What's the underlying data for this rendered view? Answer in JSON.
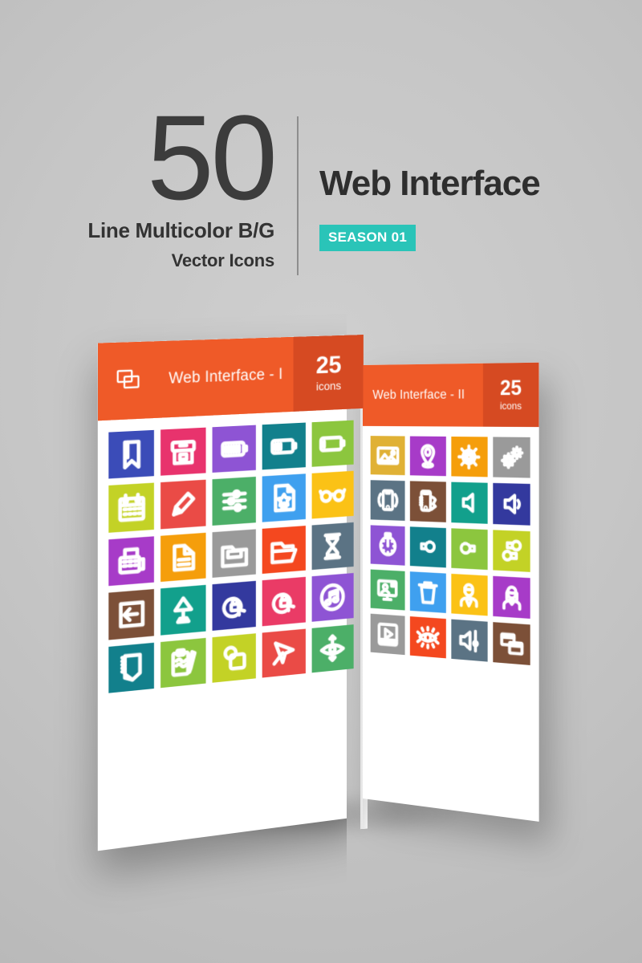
{
  "header": {
    "count": "50",
    "subtitle_1": "Line Multicolor B/G",
    "subtitle_2": "Vector Icons",
    "title": "Web Interface",
    "season_badge": "SEASON 01"
  },
  "colors": {
    "background": "#c4c4c4",
    "bar_orange": "#ef5a28",
    "bar_orange_dark": "#d64a22",
    "badge_teal": "#2ac4b8",
    "text_dark": "#2e2e2e"
  },
  "panels": [
    {
      "id": "panel-front",
      "bar_icon": "windows-icon",
      "title": "Web Interface - I",
      "count": "25",
      "count_label": "icons",
      "tiles": [
        {
          "name": "bookmark-icon",
          "color": "#3b4cb8"
        },
        {
          "name": "archive-box-icon",
          "color": "#e8336d"
        },
        {
          "name": "battery-full-icon",
          "color": "#8e54d4"
        },
        {
          "name": "battery-medium-icon",
          "color": "#12808c"
        },
        {
          "name": "battery-low-icon",
          "color": "#8cc63e"
        },
        {
          "name": "calendar-icon",
          "color": "#c3d226"
        },
        {
          "name": "pencil-edit-icon",
          "color": "#ea4b46"
        },
        {
          "name": "settings-sliders-icon",
          "color": "#4caf68"
        },
        {
          "name": "certificate-file-icon",
          "color": "#3fa0ef"
        },
        {
          "name": "glasses-icon",
          "color": "#fbc216"
        },
        {
          "name": "fax-machine-icon",
          "color": "#a73bc8"
        },
        {
          "name": "document-file-icon",
          "color": "#f59e0b"
        },
        {
          "name": "folder-file-icon",
          "color": "#9a9a9a"
        },
        {
          "name": "folder-open-icon",
          "color": "#f4481f"
        },
        {
          "name": "hourglass-icon",
          "color": "#5b7384"
        },
        {
          "name": "login-arrow-icon",
          "color": "#7c5038"
        },
        {
          "name": "desk-lamp-icon",
          "color": "#12a08c"
        },
        {
          "name": "lock-refresh-icon",
          "color": "#33399e"
        },
        {
          "name": "unlock-refresh-icon",
          "color": "#ea3b66"
        },
        {
          "name": "music-note-icon",
          "color": "#8e54d4"
        },
        {
          "name": "notebook-icon",
          "color": "#12808c"
        },
        {
          "name": "clipboard-pencil-icon",
          "color": "#8cc63e"
        },
        {
          "name": "shapes-icon",
          "color": "#c3d226"
        },
        {
          "name": "cursor-arrow-icon",
          "color": "#ea4b46"
        },
        {
          "name": "eye-move-icon",
          "color": "#4caf68"
        }
      ]
    },
    {
      "id": "panel-back",
      "title": "Web Interface - II",
      "count": "25",
      "count_label": "icons",
      "tiles": [
        {
          "name": "picture-image-icon",
          "color": "#e0b135"
        },
        {
          "name": "location-pin-icon",
          "color": "#a73bc8"
        },
        {
          "name": "gear-icon",
          "color": "#f59e0b"
        },
        {
          "name": "gears-double-icon",
          "color": "#9a9a9a"
        },
        {
          "name": "smartphone-icon",
          "color": "#5b7384"
        },
        {
          "name": "hand-phone-icon",
          "color": "#7c5038"
        },
        {
          "name": "speaker-mute-icon",
          "color": "#12a08c"
        },
        {
          "name": "speaker-low-icon",
          "color": "#33399e"
        },
        {
          "name": "stopwatch-icon",
          "color": "#8e54d4"
        },
        {
          "name": "pin-left-icon",
          "color": "#12808c"
        },
        {
          "name": "pin-right-icon",
          "color": "#8cc63e"
        },
        {
          "name": "pins-double-icon",
          "color": "#c3d226"
        },
        {
          "name": "video-call-icon",
          "color": "#4caf68"
        },
        {
          "name": "trash-bin-icon",
          "color": "#3fa0ef"
        },
        {
          "name": "user-male-icon",
          "color": "#fbc216"
        },
        {
          "name": "user-female-icon",
          "color": "#a73bc8"
        },
        {
          "name": "video-player-icon",
          "color": "#9a9a9a"
        },
        {
          "name": "eye-visibility-icon",
          "color": "#f4481f"
        },
        {
          "name": "volume-control-icon",
          "color": "#5b7384"
        },
        {
          "name": "windows-layers-icon",
          "color": "#7c5038"
        }
      ]
    }
  ]
}
